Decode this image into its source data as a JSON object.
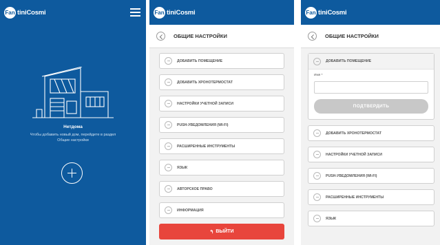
{
  "brand": {
    "logo_mark": "Fan",
    "logo_text": "tiniCosmi"
  },
  "colors": {
    "primary_blue": "#0e5a9e",
    "logout_red": "#e8453c",
    "confirm_gray": "#c8c8c8"
  },
  "home": {
    "title": "Нетдома",
    "description": "Чтобы добавить новый дом, перейдите в раздел Общие настройки",
    "icons": [
      "menu-icon",
      "house-illustration",
      "add-icon"
    ]
  },
  "settings": {
    "title": "ОБЩИЕ НАСТРОЙКИ",
    "items": [
      "ДОБАВИТЬ ПОМЕЩЕНИЕ",
      "ДОБАВИТЬ ХРОНОТЕРМОСТАТ",
      "НАСТРОЙКИ УЧЕТНОЙ ЗАПИСИ",
      "PUSH-УВЕДОМЛЕНИЯ (WI-FI)",
      "РАСШИРЕННЫЕ ИНСТРУМЕНТЫ",
      "ЯЗЫК",
      "АВТОРСКОЕ ПРАВО",
      "ИНФОРМАЦИЯ"
    ],
    "logout_label": "ВЫЙТИ"
  },
  "add_room": {
    "name_label": "Имя *",
    "name_value": "",
    "confirm_label": "ПОДТВЕРДИТЬ"
  }
}
